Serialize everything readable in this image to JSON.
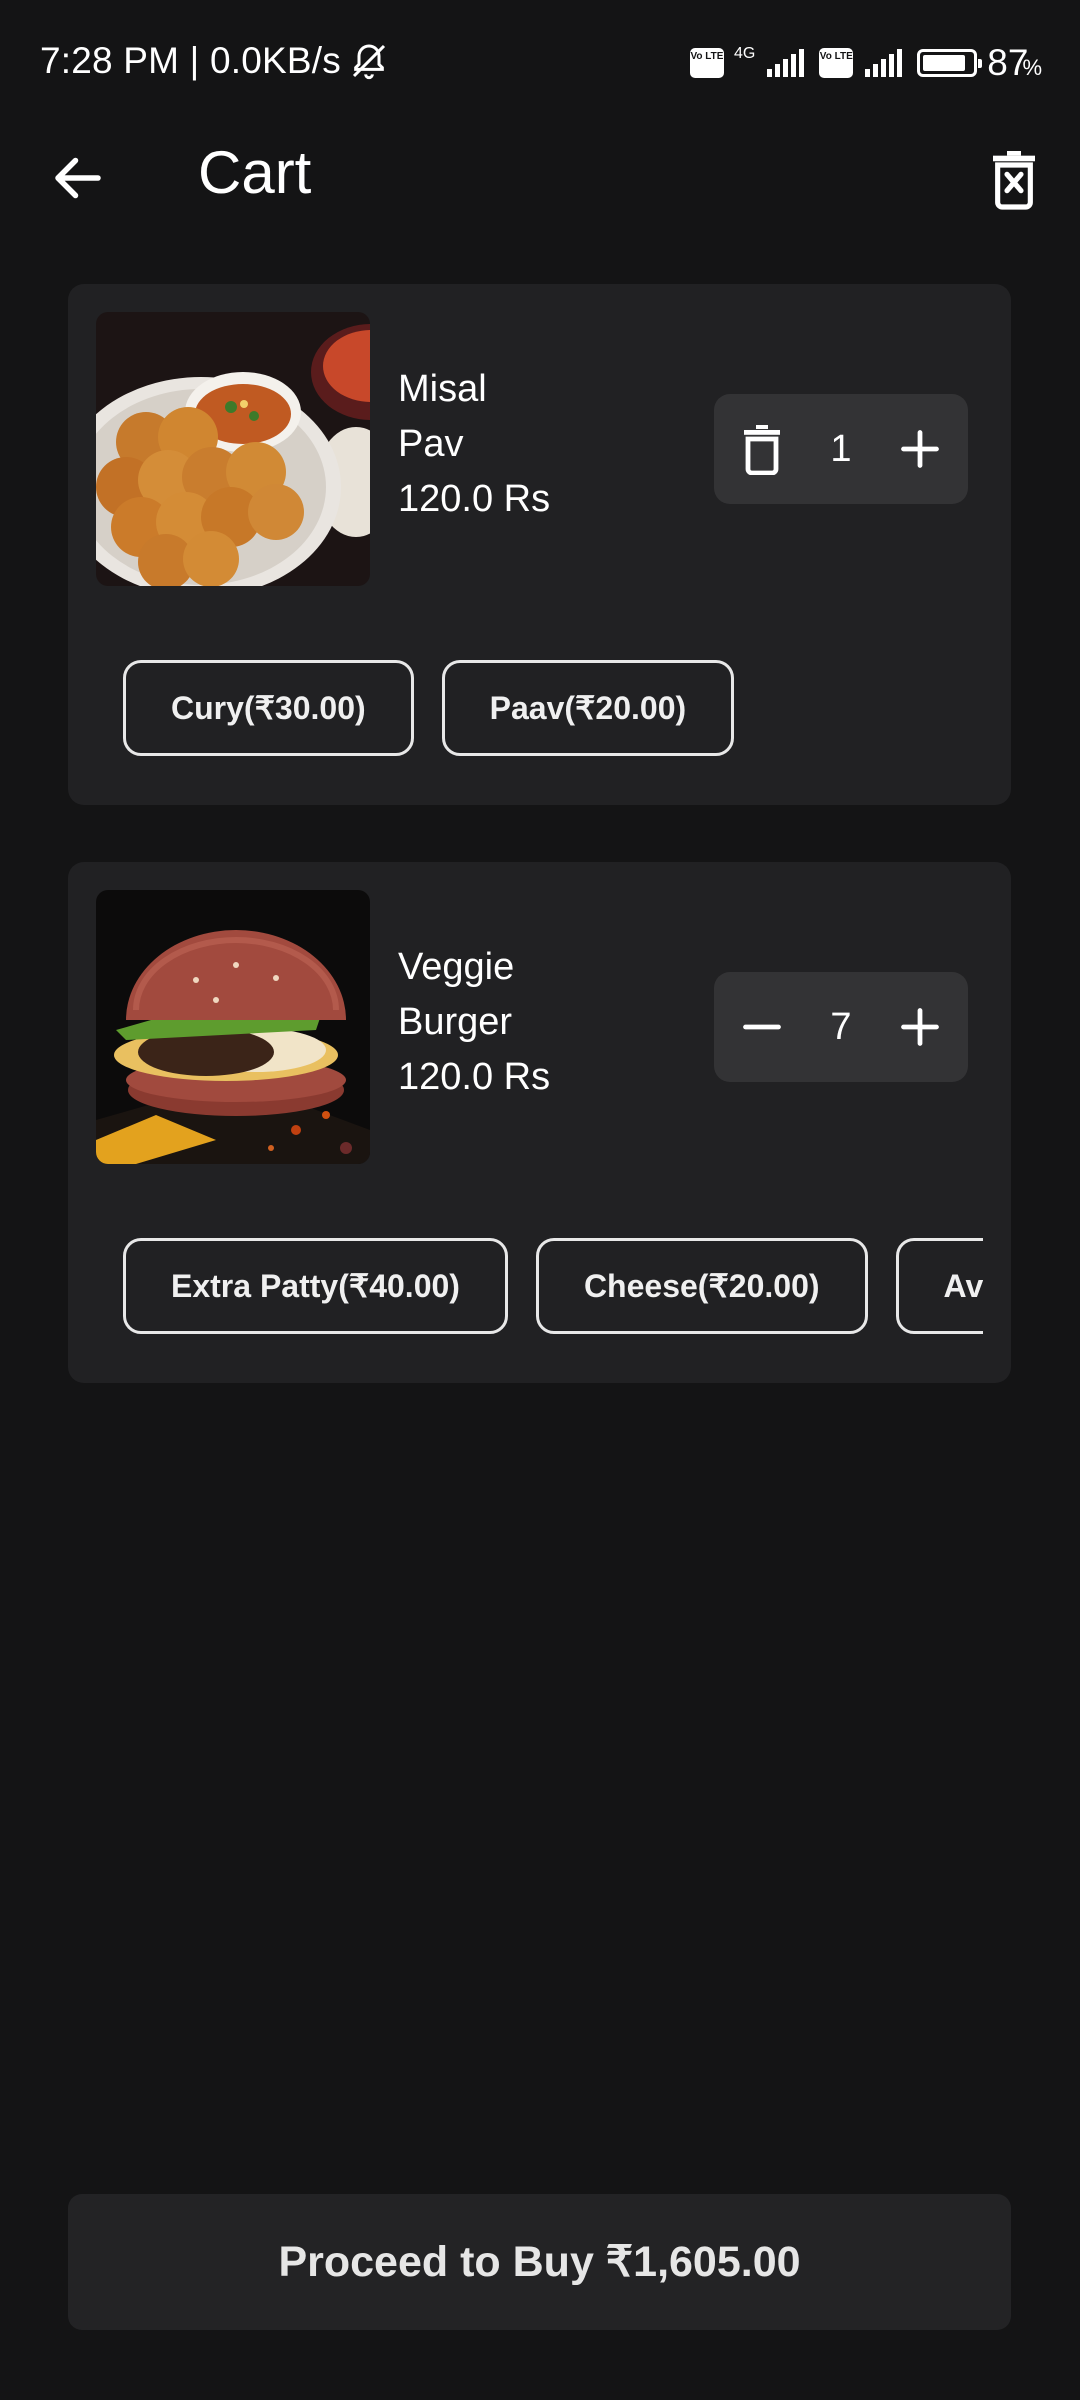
{
  "status_bar": {
    "time_speed": "7:28 PM | 0.0KB/s",
    "volte_1": "Vo LTE",
    "network_1": "4G",
    "volte_2": "Vo LTE",
    "battery_level": 0.87,
    "battery_percent": "87",
    "percent_sign": "%"
  },
  "header": {
    "title": "Cart"
  },
  "cart": {
    "items": [
      {
        "name_line1": "Misal",
        "name_line2": "Pav",
        "price": "120.0 Rs",
        "quantity": "1",
        "addons": [
          "Cury(₹30.00)",
          "Paav(₹20.00)"
        ]
      },
      {
        "name_line1": "Veggie",
        "name_line2": "Burger",
        "price": "120.0 Rs",
        "quantity": "7",
        "addons": [
          "Extra Patty(₹40.00)",
          "Cheese(₹20.00)",
          "Avocado"
        ]
      }
    ]
  },
  "checkout": {
    "label": "Proceed to Buy ₹1,605.00"
  },
  "colors": {
    "background": "#141415",
    "card": "#212123",
    "stepper": "#333335"
  }
}
